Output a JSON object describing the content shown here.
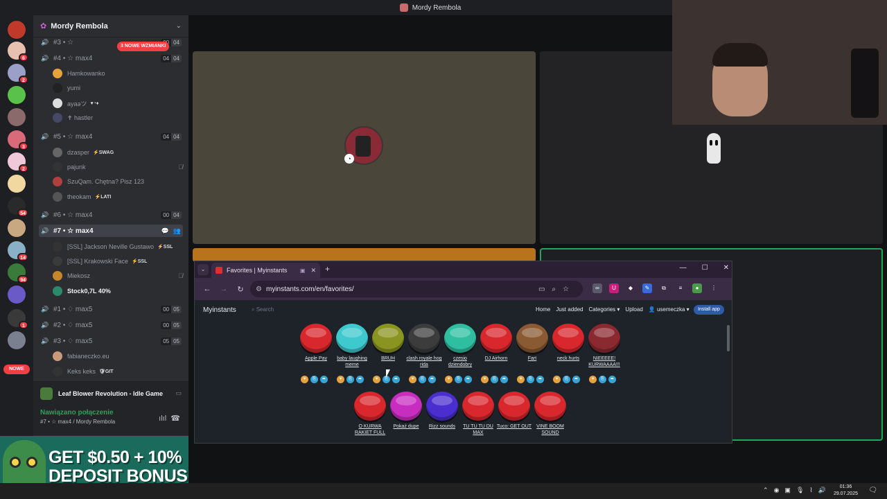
{
  "titlebar": {
    "title": "Mordy Rembola"
  },
  "rail": {
    "badges": [
      "6",
      "2",
      "3",
      "2",
      "54",
      "14",
      "94",
      "1"
    ],
    "nowe": "NOWE"
  },
  "guild": {
    "name": "Mordy Rembola",
    "mentions_pill": "3 NOWE WZMIANKI"
  },
  "voice_channels": [
    {
      "name": "#3 • ☆ ",
      "counts": [
        "00",
        "04"
      ]
    },
    {
      "name": "#4 • ☆ max4",
      "counts": [
        "04",
        "04"
      ]
    },
    {
      "name": "#5 • ☆ max4",
      "counts": [
        "04",
        "04"
      ]
    },
    {
      "name": "#6 • ☆ max4",
      "counts": [
        "00",
        "04"
      ]
    },
    {
      "name": "#7 • ☆ max4",
      "counts": []
    },
    {
      "name": "#1 • ♢ max5",
      "counts": [
        "00",
        "05"
      ]
    },
    {
      "name": "#2 • ♢ max5",
      "counts": [
        "00",
        "05"
      ]
    },
    {
      "name": "#3 • ♢ max5",
      "counts": [
        "05",
        "05"
      ]
    }
  ],
  "users": [
    {
      "name": "Hamkowanko",
      "tag": ""
    },
    {
      "name": "yumi",
      "tag": ""
    },
    {
      "name": "ayaəツ",
      "tag": ""
    },
    {
      "name": "✝ hastler",
      "tag": ""
    },
    {
      "name": "dzasper",
      "tag": "⚡SWAG"
    },
    {
      "name": "pajunk",
      "tag": ""
    },
    {
      "name": "SzuQam. Chętna? Pisz 123",
      "tag": ""
    },
    {
      "name": "theokam",
      "tag": "⚡LATI"
    },
    {
      "name": "[SSL] Jackson Neville Gustawo",
      "tag": "⚡SSL"
    },
    {
      "name": "[SSL] Krakowski Face",
      "tag": "⚡SSL"
    },
    {
      "name": "Miekosz",
      "tag": ""
    },
    {
      "name": "Stock0,7L 40%",
      "tag": ""
    },
    {
      "name": "fabianeczko.eu",
      "tag": ""
    },
    {
      "name": "Keks keks",
      "tag": "🛡GIT"
    }
  ],
  "activity": {
    "title": "Leaf Blower Revolution - Idle Game"
  },
  "voice_status": {
    "state": "Nawiązano połączenie",
    "channel": "#7 • ☆ max4 / Mordy Rembola"
  },
  "ad": {
    "text": "GET $0.50 + 10% DEPOSIT BONUS"
  },
  "browser": {
    "tab_title": "Favorites | Myinstants",
    "url": "myinstants.com/en/favorites/",
    "site_name": "Myinstants",
    "search_placeholder": "Search",
    "nav": [
      "Home",
      "Just added",
      "Categories ▾",
      "Upload",
      "usemeczka ▾"
    ],
    "install": "Install app"
  },
  "instants": [
    {
      "label": "Apple Pay",
      "color": "#d9272e"
    },
    {
      "label": "baby laughing meme",
      "color": "#3ec9cf"
    },
    {
      "label": "BRUH",
      "color": "#8a9420"
    },
    {
      "label": "clash royale hog rida",
      "color": "#3c3c3c"
    },
    {
      "label": "czesio dziendobry",
      "color": "#2fbfa0"
    },
    {
      "label": "DJ Airhorn",
      "color": "#d9272e"
    },
    {
      "label": "Fart",
      "color": "#8a5a32"
    },
    {
      "label": "neck hurts",
      "color": "#d9272e"
    },
    {
      "label": "NIEEEEE! KURWAAAA!!!",
      "color": "#8a2a30"
    },
    {
      "label": "O KURWA RAKIET FULL",
      "color": "#d9272e"
    },
    {
      "label": "Pokaż dupe",
      "color": "#c72ec0"
    },
    {
      "label": "Rizz sounds",
      "color": "#4a2ed0"
    },
    {
      "label": "TU TU TU DU MAX",
      "color": "#d9272e"
    },
    {
      "label": "Tuco: GET OUT",
      "color": "#d9272e"
    },
    {
      "label": "VINE BOOM SOUND",
      "color": "#d9272e"
    }
  ],
  "taskbar": {
    "time": "01:36",
    "date": "29.07.2025"
  }
}
